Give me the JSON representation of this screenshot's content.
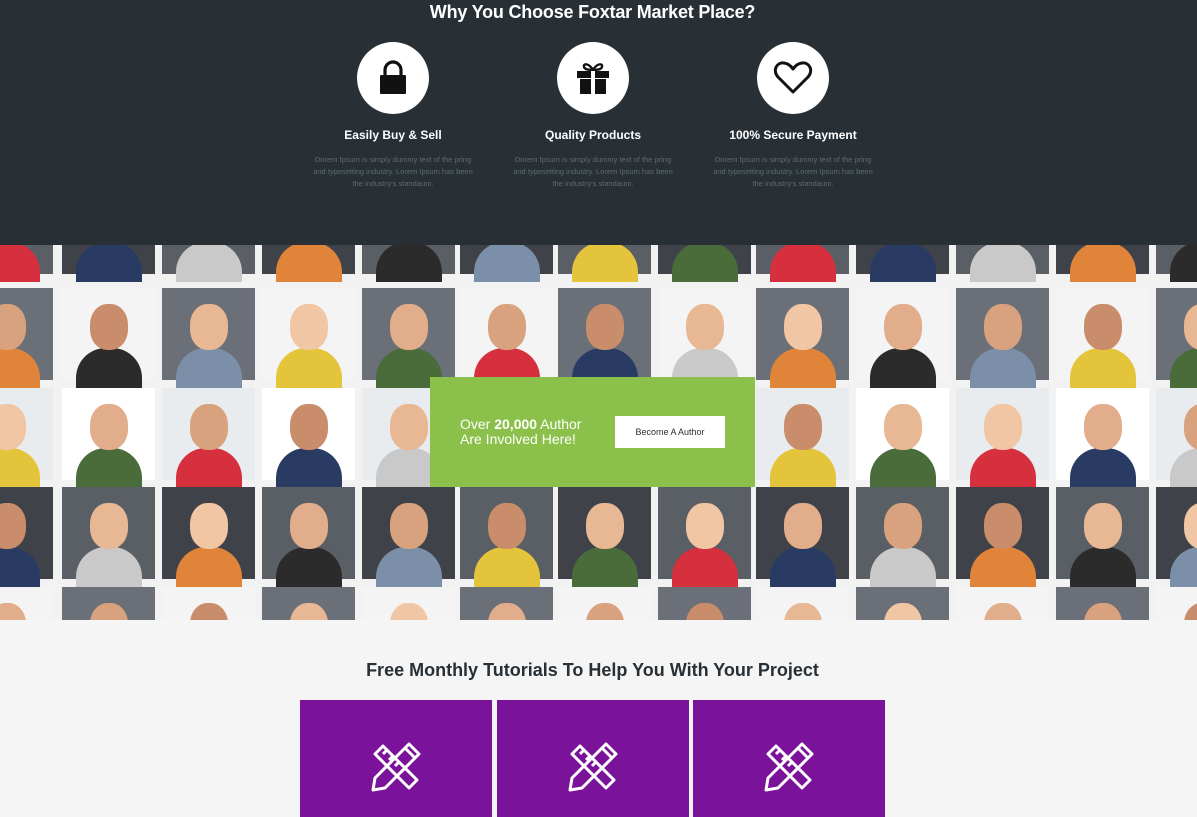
{
  "why": {
    "title": "Why You Choose Foxtar Market Place?",
    "features": [
      {
        "icon": "lock-icon",
        "title": "Easily Buy & Sell",
        "description": "Dorem Ipsum is simply dummy text of the pring and typesetting industry. Lorem Ipsum has been the industry's standaum."
      },
      {
        "icon": "gift-icon",
        "title": "Quality Products",
        "description": "Dorem Ipsum is simply dummy text of the pring and typesetting industry. Lorem Ipsum has been the industry's standaum."
      },
      {
        "icon": "heart-icon",
        "title": "100% Secure Payment",
        "description": "Dorem Ipsum is simply dummy text of the pring and typesetting industry. Lorem Ipsum has been the industry's standaum."
      }
    ]
  },
  "authors": {
    "prefix": "Over ",
    "count": "20,000",
    "suffix": " Author",
    "line2": "Are Involved Here!",
    "button_label": "Become A Author"
  },
  "tutorials": {
    "title": "Free Monthly Tutorials To Help You With Your Project",
    "cards": [
      {
        "icon": "pencil-ruler-icon"
      },
      {
        "icon": "pencil-ruler-icon"
      },
      {
        "icon": "pencil-ruler-icon"
      }
    ]
  },
  "colors": {
    "dark_bg": "#283036",
    "accent_green": "#8bc04a",
    "accent_purple": "#7a129a",
    "light_bg": "#f4f5f4"
  }
}
